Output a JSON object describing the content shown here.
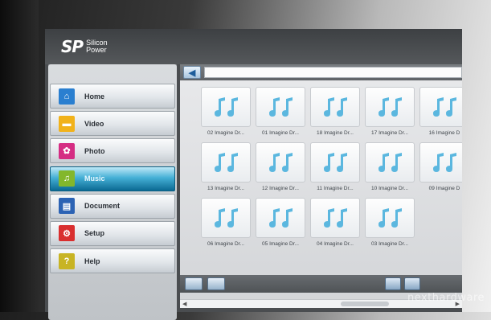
{
  "header": {
    "logo_mark": "SP",
    "logo_line1": "Silicon",
    "logo_line2": "Power"
  },
  "sidebar": {
    "items": [
      {
        "label": "Home",
        "icon": "home-icon",
        "color": "#2a7fd0",
        "glyph": "⌂",
        "active": false
      },
      {
        "label": "Video",
        "icon": "video-icon",
        "color": "#f1b21b",
        "glyph": "▬",
        "active": false
      },
      {
        "label": "Photo",
        "icon": "photo-icon",
        "color": "#d52d83",
        "glyph": "✿",
        "active": false
      },
      {
        "label": "Music",
        "icon": "music-icon",
        "color": "#83b72c",
        "glyph": "♫",
        "active": true
      },
      {
        "label": "Document",
        "icon": "document-icon",
        "color": "#2c63b4",
        "glyph": "▤",
        "active": false
      },
      {
        "label": "Setup",
        "icon": "setup-icon",
        "color": "#d92f2f",
        "glyph": "⚙",
        "active": false
      },
      {
        "label": "Help",
        "icon": "help-icon",
        "color": "#c8b424",
        "glyph": "?",
        "active": false
      }
    ]
  },
  "toolbar": {
    "back_icon": "back-arrow-icon"
  },
  "files": [
    "02 Imagine Dr...",
    "01 Imagine Dr...",
    "18 Imagine Dr...",
    "17 Imagine Dr...",
    "16 Imagine D",
    "13 Imagine Dr...",
    "12 Imagine Dr...",
    "11 Imagine Dr...",
    "10 Imagine Dr...",
    "09 Imagine D",
    "06 Imagine Dr...",
    "05 Imagine Dr...",
    "04 Imagine Dr...",
    "03 Imagine Dr..."
  ],
  "file_icon": "music-note-icon",
  "watermark": "nexthardware"
}
